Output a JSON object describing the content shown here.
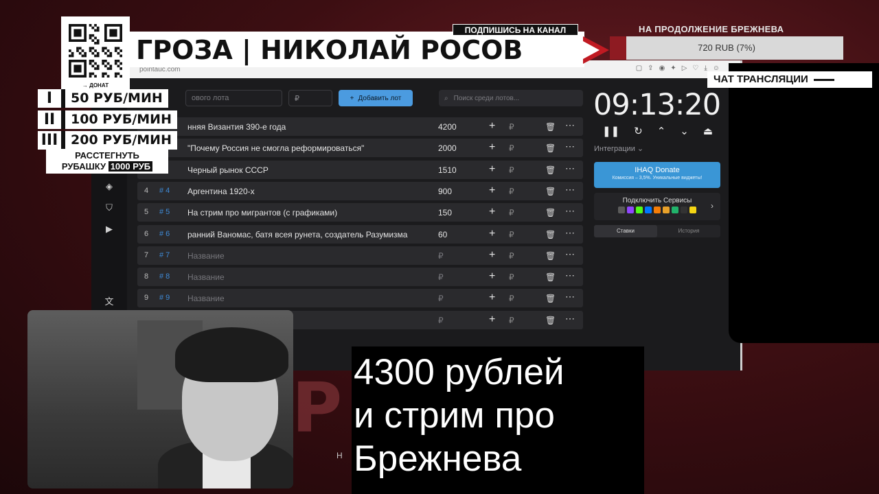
{
  "banner": {
    "subscribe": "ПОДПИШИСЬ НА КАНАЛ",
    "title": "ГРОЗА | НИКОЛАЙ РОСОВ"
  },
  "donate": {
    "qr_label": "→ ДОНАТ"
  },
  "goal": {
    "caption": "НА ПРОДОЛЖЕНИЕ БРЕЖНЕВА",
    "amount": "720 RUB (7%)",
    "progress_percent": 7
  },
  "chat": {
    "header": "ЧАТ ТРАНСЛЯЦИИ"
  },
  "rates": [
    {
      "mark": "I",
      "text": "50 РУБ/МИН"
    },
    {
      "mark": "II",
      "text": "100 РУБ/МИН"
    },
    {
      "mark": "III",
      "text": "200 РУБ/МИН"
    }
  ],
  "shirt": {
    "line1": "РАССТЕГНУТЬ",
    "line2": "РУБАШКУ",
    "price": "1000 РУБ"
  },
  "browser": {
    "url": "pointauc.com"
  },
  "app": {
    "lot_placeholder": "ового лота",
    "price_placeholder": "₽",
    "add_button": "Добавить лот",
    "search_placeholder": "Поиск среди лотов...",
    "lots": [
      {
        "num": "",
        "id": "",
        "name": "нняя Византия 390-е года",
        "sum": "4200"
      },
      {
        "num": "",
        "id": "",
        "name": "\"Почему Россия не смогла реформироваться\"",
        "sum": "2000"
      },
      {
        "num": "",
        "id": "",
        "name": "Черный рынок СССР",
        "sum": "1510"
      },
      {
        "num": "4",
        "id": "# 4",
        "name": "Аргентина 1920-х",
        "sum": "900"
      },
      {
        "num": "5",
        "id": "# 5",
        "name": "На стрим про мигрантов (с графиками)",
        "sum": "150"
      },
      {
        "num": "6",
        "id": "# 6",
        "name": "ранний Ваномас, батя всея рунета, создатель Разумизма",
        "sum": "60"
      },
      {
        "num": "7",
        "id": "# 7",
        "name": "Название",
        "sum": "₽"
      },
      {
        "num": "8",
        "id": "# 8",
        "name": "Название",
        "sum": "₽"
      },
      {
        "num": "9",
        "id": "# 9",
        "name": "Название",
        "sum": "₽"
      },
      {
        "num": "",
        "id": "",
        "name": "",
        "sum": "₽"
      }
    ],
    "rub_sign": "₽",
    "timer": "09:13:20",
    "integrations_label": "Интеграции ⌄",
    "donate_card": {
      "title": "IHAQ Donate",
      "subtitle": "Комиссия – 3,5%. Уникальные виджеты!"
    },
    "services_card": {
      "title": "Подключить Сервисы"
    },
    "tabs": [
      {
        "label": "Ставки"
      },
      {
        "label": "История"
      }
    ]
  },
  "caption": {
    "line1": "4300 рублей",
    "line2": "и стрим про",
    "line3": "Брежнева"
  },
  "bg_logo": {
    "text": "Р    В",
    "sub": "Н              С О В"
  }
}
